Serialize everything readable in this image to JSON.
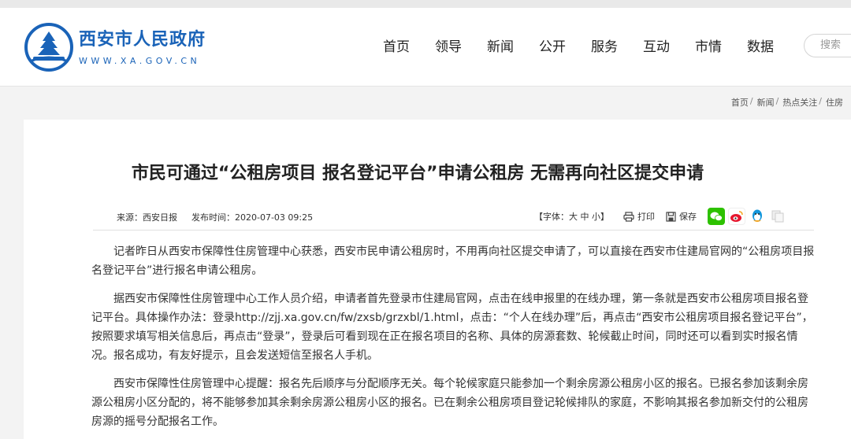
{
  "site": {
    "title": "西安市人民政府",
    "url": "WWW.XA.GOV.CN"
  },
  "nav": [
    "首页",
    "领导",
    "新闻",
    "公开",
    "服务",
    "互动",
    "市情",
    "数据"
  ],
  "search": {
    "placeholder": "搜索"
  },
  "breadcrumb": [
    "首页",
    "新闻",
    "热点关注",
    "住房"
  ],
  "article": {
    "title": "市民可通过“公租房项目 报名登记平台”申请公租房 无需再向社区提交申请",
    "source": "来源：西安日报",
    "published": "发布时间：2020-07-03 09:25",
    "font_label": "【字体：",
    "font_large": "大",
    "font_medium": "中",
    "font_small": "小",
    "font_end": "】",
    "print": "打印",
    "save": "保存",
    "paragraphs": [
      "记者昨日从西安市保障性住房管理中心获悉，西安市民申请公租房时，不用再向社区提交申请了，可以直接在西安市住建局官网的“公租房项目报名登记平台”进行报名申请公租房。",
      "据西安市保障性住房管理中心工作人员介绍，申请者首先登录市住建局官网，点击在线申报里的在线办理，第一条就是西安市公租房项目报名登记平台。具体操作办法：登录http://zjj.xa.gov.cn/fw/zxsb/grzxbl/1.html，点击：“个人在线办理”后，再点击“西安市公租房项目报名登记平台”，按照要求填写相关信息后，再点击“登录”，登录后可看到现在正在报名项目的名称、具体的房源套数、轮候截止时间，同时还可以看到实时报名情况。报名成功，有友好提示，且会发送短信至报名人手机。",
      "西安市保障性住房管理中心提醒：报名先后顺序与分配顺序无关。每个轮候家庭只能参加一个剩余房源公租房小区的报名。已报名参加该剩余房源公租房小区分配的，将不能够参加其余剩余房源公租房小区的报名。已在剩余公租房项目登记轮候排队的家庭，不影响其报名参加新交付的公租房房源的摇号分配报名工作。"
    ]
  },
  "colors": {
    "brand": "#1a63b8",
    "wechat": "#2dc100",
    "weibo": "#e6162d",
    "qq": "#1296db"
  }
}
